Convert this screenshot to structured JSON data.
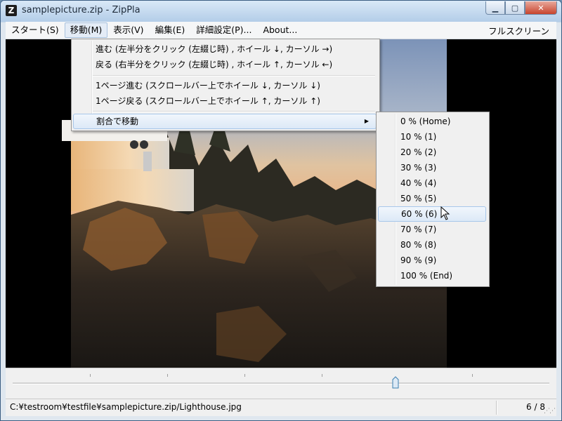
{
  "window": {
    "title": "samplepicture.zip - ZipPla",
    "app_icon_letter": "Z"
  },
  "menubar": {
    "items": [
      "スタート(S)",
      "移動(M)",
      "表示(V)",
      "編集(E)",
      "詳細設定(P)...",
      "About..."
    ],
    "right": "フルスクリーン"
  },
  "move_menu": {
    "items": [
      "進む (左半分をクリック (左綴じ時) , ホイール ↓, カーソル →)",
      "戻る (右半分をクリック (左綴じ時) , ホイール ↑, カーソル ←)",
      "1ページ進む (スクロールバー上でホイール ↓, カーソル ↓)",
      "1ページ戻る (スクロールバー上でホイール ↑, カーソル ↑)",
      "割合で移動"
    ]
  },
  "percent_submenu": {
    "items": [
      "0 % (Home)",
      "10 % (1)",
      "20 % (2)",
      "30 % (3)",
      "40 % (4)",
      "50 % (5)",
      "60 % (6)",
      "70 % (7)",
      "80 % (8)",
      "90 % (9)",
      "100 % (End)"
    ]
  },
  "slider": {
    "position_fraction": 0.714
  },
  "statusbar": {
    "path": "C:¥testroom¥testfile¥samplepicture.zip/Lighthouse.jpg",
    "page": "6 / 8"
  }
}
